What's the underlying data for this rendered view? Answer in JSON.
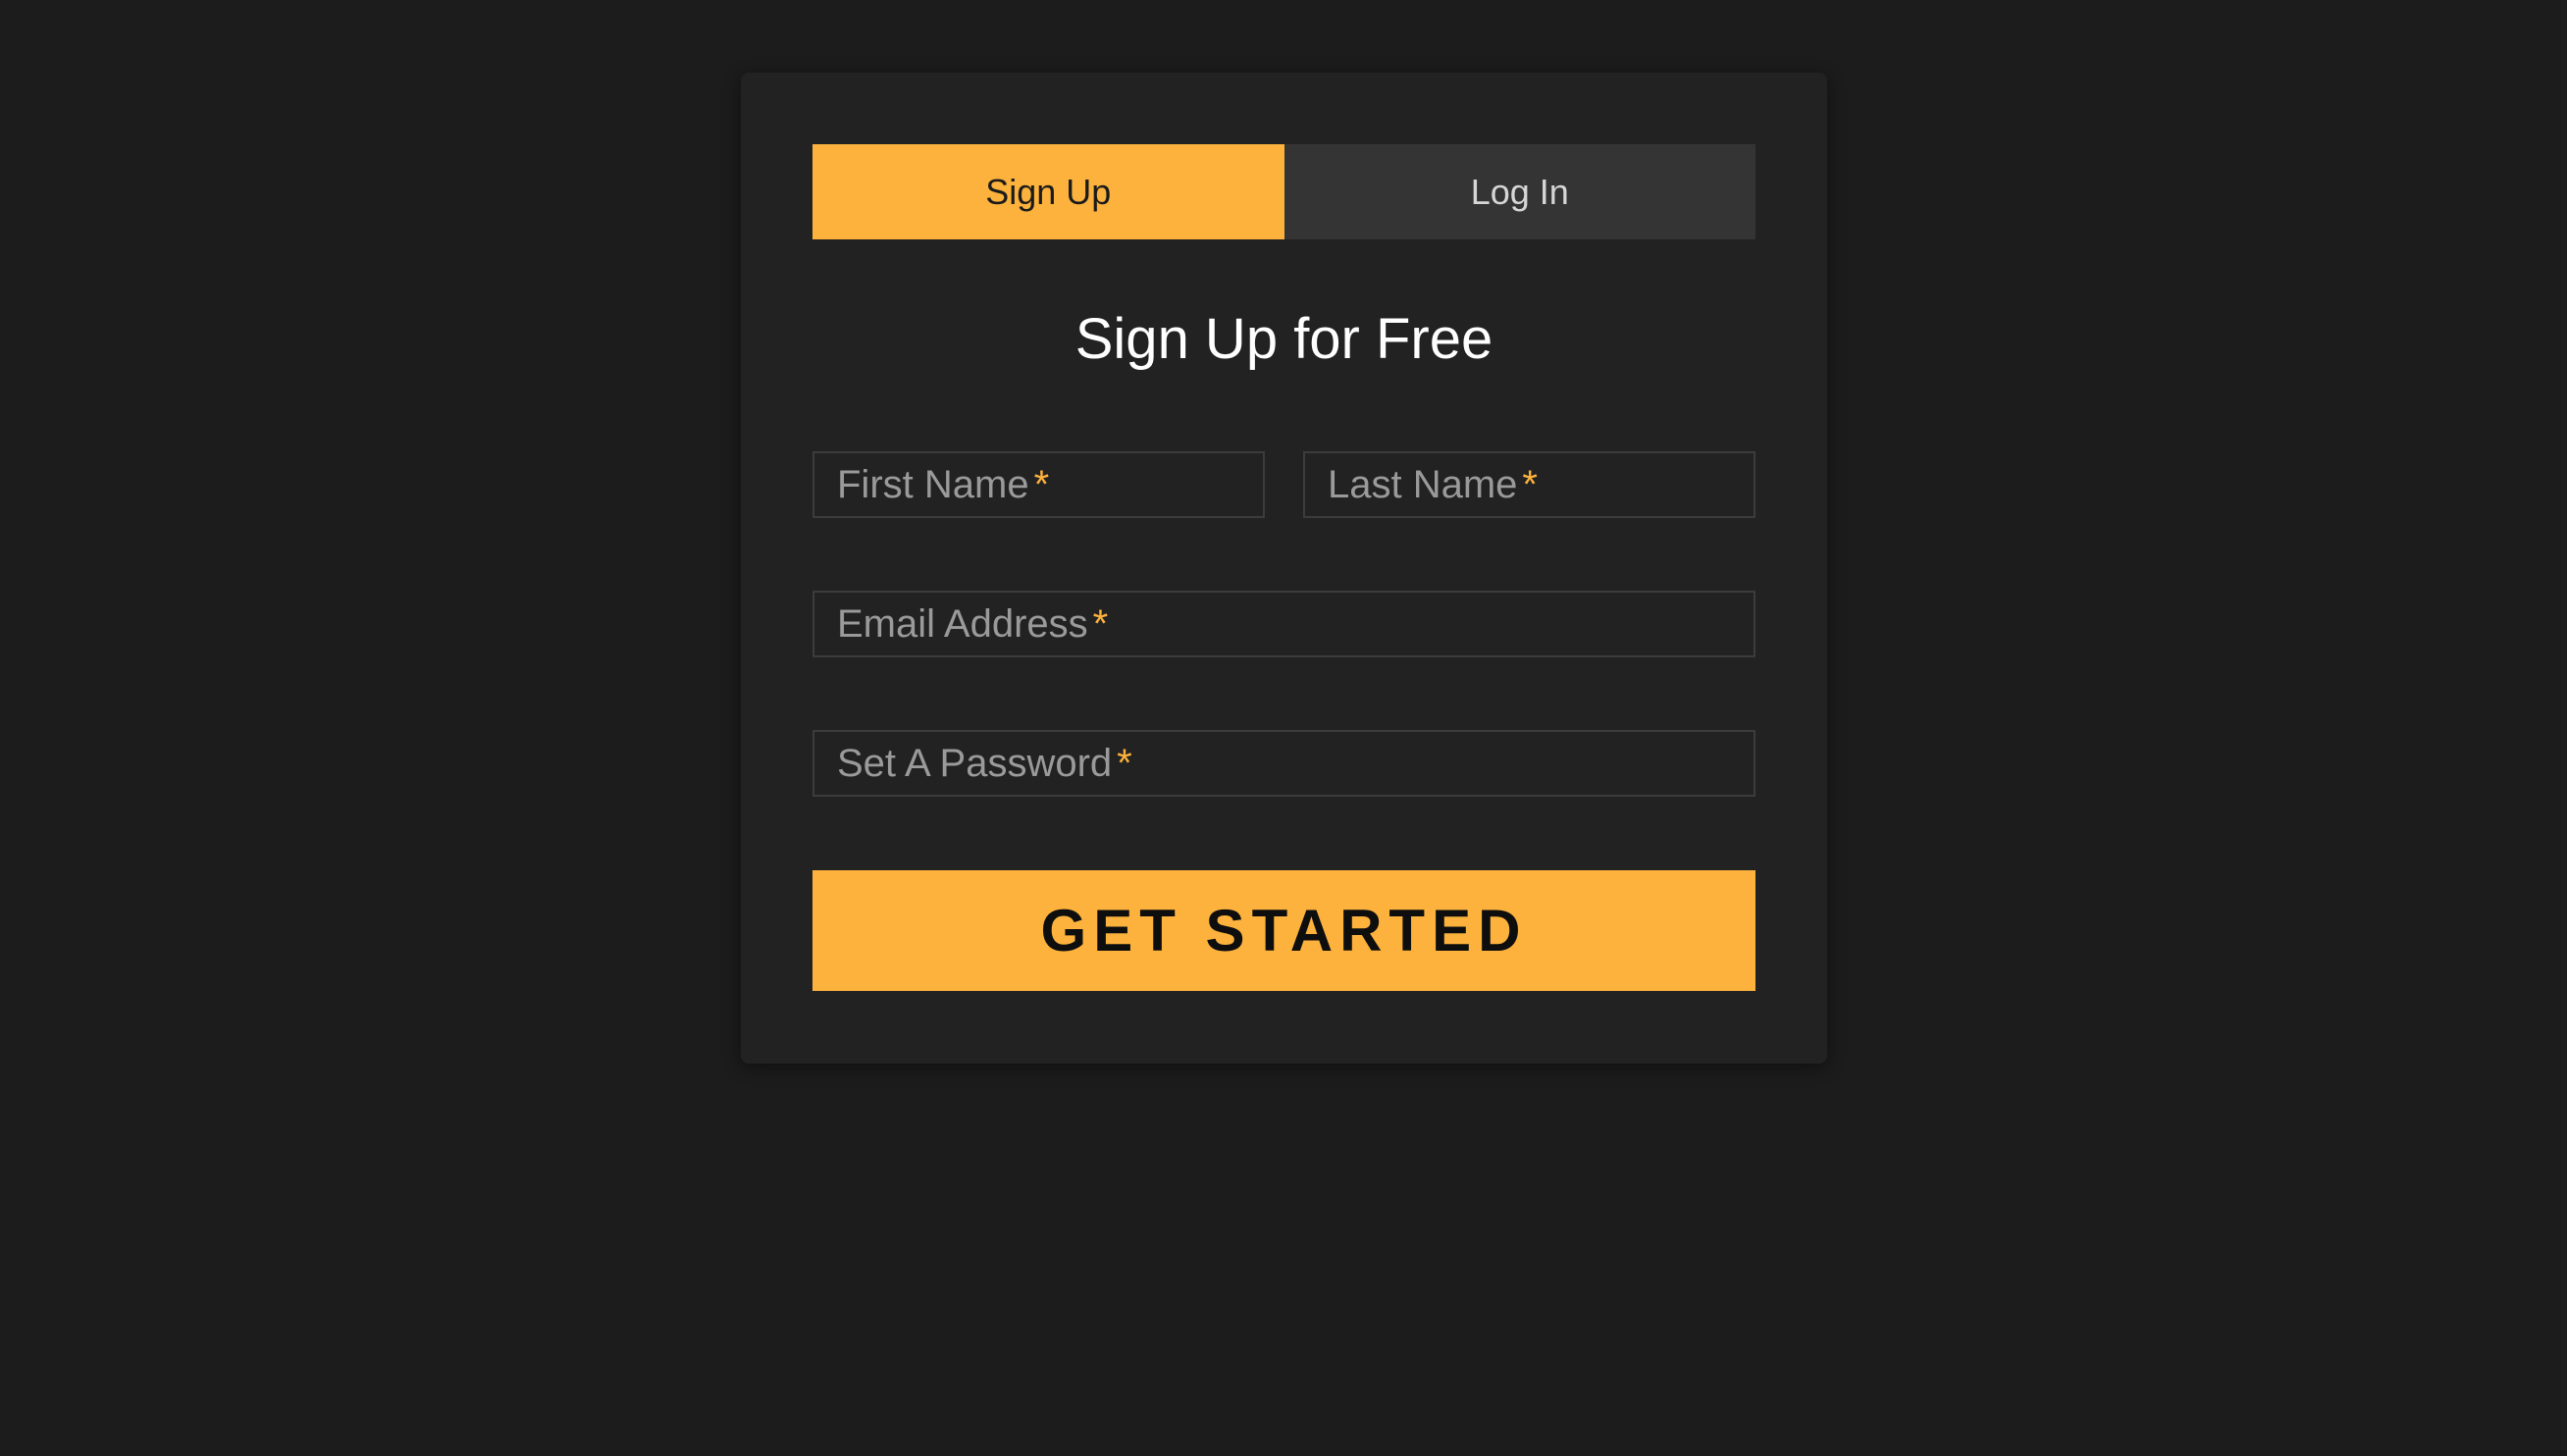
{
  "tabs": [
    {
      "label": "Sign Up",
      "active": true
    },
    {
      "label": "Log In",
      "active": false
    }
  ],
  "form": {
    "heading": "Sign Up for Free",
    "fields": {
      "first_name": {
        "placeholder": "First Name",
        "required_mark": "*",
        "value": ""
      },
      "last_name": {
        "placeholder": "Last Name",
        "required_mark": "*",
        "value": ""
      },
      "email": {
        "placeholder": "Email Address",
        "required_mark": "*",
        "value": ""
      },
      "password": {
        "placeholder": "Set A Password",
        "required_mark": "*",
        "value": ""
      }
    },
    "submit_label": "GET STARTED"
  },
  "colors": {
    "accent": "#fcb23c",
    "background": "#1c1c1c",
    "card": "#222222",
    "inactive_tab": "#343434"
  }
}
